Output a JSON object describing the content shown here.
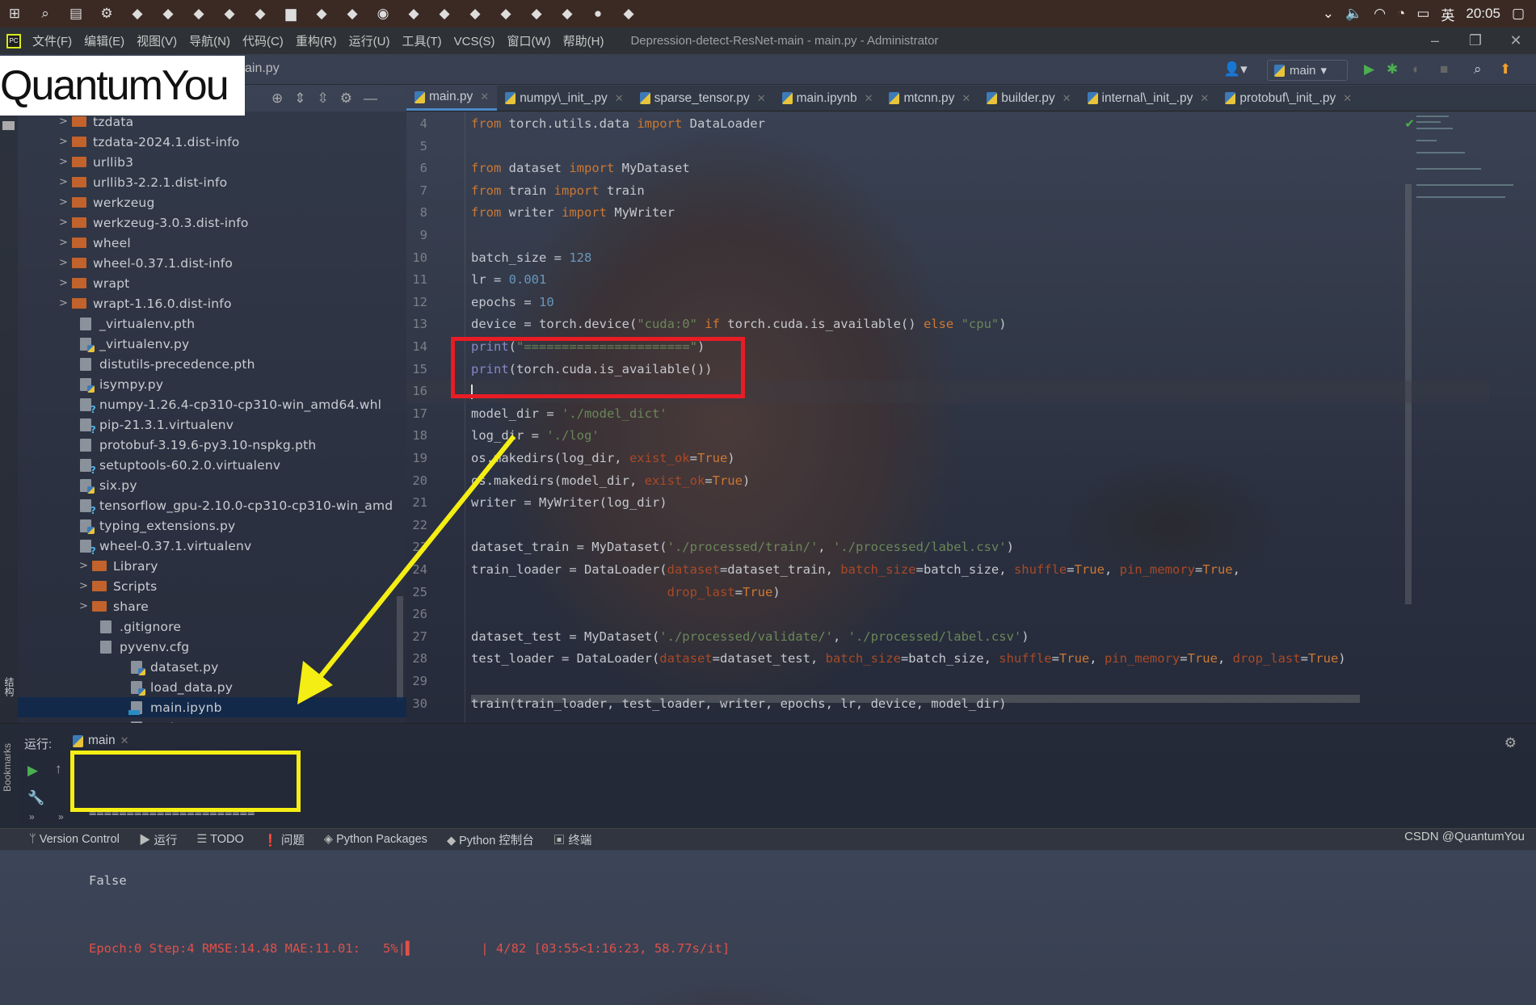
{
  "taskbar": {
    "icons": [
      "windows-icon",
      "search-icon",
      "task-view-icon",
      "gear-icon",
      "app-icon",
      "app-icon",
      "app-icon",
      "app-icon",
      "app-icon",
      "folder-icon",
      "search-app-icon",
      "app-icon",
      "edge-icon",
      "app-icon",
      "sublime-icon",
      "pycharm-icon",
      "app-icon",
      "app-icon",
      "app-icon",
      "wechat-icon",
      "app-icon"
    ],
    "ime": "英",
    "clock": "20:05"
  },
  "menubar": {
    "items": [
      "文件(F)",
      "编辑(E)",
      "视图(V)",
      "导航(N)",
      "代码(C)",
      "重构(R)",
      "运行(U)",
      "工具(T)",
      "VCS(S)",
      "窗口(W)",
      "帮助(H)"
    ],
    "title": "Depression-detect-ResNet-main - main.py - Administrator"
  },
  "watermark": "QuantumYou",
  "breadcrumb": "ain.py",
  "run_config": "main",
  "tabs": [
    {
      "label": "main.py",
      "active": true
    },
    {
      "label": "numpy\\_init_.py"
    },
    {
      "label": "sparse_tensor.py"
    },
    {
      "label": "main.ipynb",
      "type": "notebook"
    },
    {
      "label": "mtcnn.py"
    },
    {
      "label": "builder.py"
    },
    {
      "label": "internal\\_init_.py"
    },
    {
      "label": "protobuf\\_init_.py"
    }
  ],
  "tree": [
    {
      "label": "tzdata",
      "type": "folder",
      "depth": 2
    },
    {
      "label": "tzdata-2024.1.dist-info",
      "type": "folder",
      "depth": 2
    },
    {
      "label": "urllib3",
      "type": "folder",
      "depth": 2
    },
    {
      "label": "urllib3-2.2.1.dist-info",
      "type": "folder",
      "depth": 2
    },
    {
      "label": "werkzeug",
      "type": "folder",
      "depth": 2
    },
    {
      "label": "werkzeug-3.0.3.dist-info",
      "type": "folder",
      "depth": 2
    },
    {
      "label": "wheel",
      "type": "folder",
      "depth": 2
    },
    {
      "label": "wheel-0.37.1.dist-info",
      "type": "folder",
      "depth": 2
    },
    {
      "label": "wrapt",
      "type": "folder",
      "depth": 2
    },
    {
      "label": "wrapt-1.16.0.dist-info",
      "type": "folder",
      "depth": 2
    },
    {
      "label": "_virtualenv.pth",
      "type": "text",
      "depth": 2
    },
    {
      "label": "_virtualenv.py",
      "type": "py",
      "depth": 2
    },
    {
      "label": "distutils-precedence.pth",
      "type": "text",
      "depth": 2
    },
    {
      "label": "isympy.py",
      "type": "py",
      "depth": 2
    },
    {
      "label": "numpy-1.26.4-cp310-cp310-win_amd64.whl",
      "type": "unknown",
      "depth": 2
    },
    {
      "label": "pip-21.3.1.virtualenv",
      "type": "unknown",
      "depth": 2
    },
    {
      "label": "protobuf-3.19.6-py3.10-nspkg.pth",
      "type": "text",
      "depth": 2
    },
    {
      "label": "setuptools-60.2.0.virtualenv",
      "type": "unknown",
      "depth": 2
    },
    {
      "label": "six.py",
      "type": "py",
      "depth": 2
    },
    {
      "label": "tensorflow_gpu-2.10.0-cp310-cp310-win_amd",
      "type": "unknown",
      "depth": 2
    },
    {
      "label": "typing_extensions.py",
      "type": "py",
      "depth": 2
    },
    {
      "label": "wheel-0.37.1.virtualenv",
      "type": "unknown",
      "depth": 2
    },
    {
      "label": "Library",
      "type": "folder",
      "depth": 1
    },
    {
      "label": "Scripts",
      "type": "folder",
      "depth": 1
    },
    {
      "label": "share",
      "type": "folder",
      "depth": 1
    },
    {
      "label": ".gitignore",
      "type": "text",
      "depth": 1
    },
    {
      "label": "pyvenv.cfg",
      "type": "text",
      "depth": 1
    },
    {
      "label": "dataset.py",
      "type": "py",
      "depth": 0
    },
    {
      "label": "load_data.py",
      "type": "py",
      "depth": 0
    },
    {
      "label": "main.ipynb",
      "type": "nb",
      "depth": 0,
      "selected": true
    },
    {
      "label": "main.py",
      "type": "py",
      "depth": 0
    }
  ],
  "code": [
    {
      "n": "4",
      "t": [
        [
          "from",
          "kw"
        ],
        [
          " torch.utils.data ",
          "id"
        ],
        [
          "import",
          "kw"
        ],
        [
          " DataLoader",
          "id"
        ]
      ]
    },
    {
      "n": "5",
      "t": []
    },
    {
      "n": "6",
      "t": [
        [
          "from",
          "kw"
        ],
        [
          " dataset ",
          "id"
        ],
        [
          "import",
          "kw"
        ],
        [
          " MyDataset",
          "id"
        ]
      ]
    },
    {
      "n": "7",
      "t": [
        [
          "from",
          "kw"
        ],
        [
          " train ",
          "id"
        ],
        [
          "import",
          "kw"
        ],
        [
          " train",
          "id"
        ]
      ]
    },
    {
      "n": "8",
      "t": [
        [
          "from",
          "kw"
        ],
        [
          " writer ",
          "id"
        ],
        [
          "import",
          "kw"
        ],
        [
          " MyWriter",
          "id"
        ]
      ]
    },
    {
      "n": "9",
      "t": []
    },
    {
      "n": "10",
      "t": [
        [
          "batch_size = ",
          "id"
        ],
        [
          "128",
          "num"
        ]
      ]
    },
    {
      "n": "11",
      "t": [
        [
          "lr = ",
          "id"
        ],
        [
          "0.001",
          "num"
        ]
      ]
    },
    {
      "n": "12",
      "t": [
        [
          "epochs = ",
          "id"
        ],
        [
          "10",
          "num"
        ]
      ]
    },
    {
      "n": "13",
      "t": [
        [
          "device = torch.device(",
          "id"
        ],
        [
          "\"cuda:0\"",
          "str"
        ],
        [
          " if ",
          "kw"
        ],
        [
          "torch.cuda.is_available() ",
          "id"
        ],
        [
          "else",
          "kw"
        ],
        [
          " \"cpu\"",
          "str"
        ],
        [
          ")",
          "id"
        ]
      ]
    },
    {
      "n": "14",
      "t": [
        [
          "print",
          "bi"
        ],
        [
          "(",
          "id"
        ],
        [
          "\"======================\"",
          "str"
        ],
        [
          ")",
          "id"
        ]
      ]
    },
    {
      "n": "15",
      "t": [
        [
          "print",
          "bi"
        ],
        [
          "(torch.cuda.is_available())",
          "id"
        ]
      ]
    },
    {
      "n": "16",
      "t": [],
      "current": true
    },
    {
      "n": "17",
      "t": [
        [
          "model_dir = ",
          "id"
        ],
        [
          "'./model_dict'",
          "str"
        ]
      ]
    },
    {
      "n": "18",
      "t": [
        [
          "log_dir = ",
          "id"
        ],
        [
          "'./log'",
          "str"
        ]
      ]
    },
    {
      "n": "19",
      "t": [
        [
          "os.makedirs(log_dir, ",
          "id"
        ],
        [
          "exist_ok",
          "param"
        ],
        [
          "=",
          "id"
        ],
        [
          "True",
          "kw"
        ],
        [
          ")",
          "id"
        ]
      ]
    },
    {
      "n": "20",
      "t": [
        [
          "os.makedirs(model_dir, ",
          "id"
        ],
        [
          "exist_ok",
          "param"
        ],
        [
          "=",
          "id"
        ],
        [
          "True",
          "kw"
        ],
        [
          ")",
          "id"
        ]
      ]
    },
    {
      "n": "21",
      "t": [
        [
          "writer = MyWriter(log_dir)",
          "id"
        ]
      ]
    },
    {
      "n": "22",
      "t": []
    },
    {
      "n": "23",
      "t": [
        [
          "dataset_train = MyDataset(",
          "id"
        ],
        [
          "'./processed/train/'",
          "str"
        ],
        [
          ", ",
          "id"
        ],
        [
          "'./processed/label.csv'",
          "str"
        ],
        [
          ")",
          "id"
        ]
      ]
    },
    {
      "n": "24",
      "t": [
        [
          "train_loader = DataLoader(",
          "id"
        ],
        [
          "dataset",
          "param"
        ],
        [
          "=dataset_train, ",
          "id"
        ],
        [
          "batch_size",
          "param"
        ],
        [
          "=batch_size, ",
          "id"
        ],
        [
          "shuffle",
          "param"
        ],
        [
          "=",
          "id"
        ],
        [
          "True",
          "kw"
        ],
        [
          ", ",
          "id"
        ],
        [
          "pin_memory",
          "param"
        ],
        [
          "=",
          "id"
        ],
        [
          "True",
          "kw"
        ],
        [
          ",",
          "id"
        ]
      ]
    },
    {
      "n": "25",
      "t": [
        [
          "                          ",
          "id"
        ],
        [
          "drop_last",
          "param"
        ],
        [
          "=",
          "id"
        ],
        [
          "True",
          "kw"
        ],
        [
          ")",
          "id"
        ]
      ]
    },
    {
      "n": "26",
      "t": []
    },
    {
      "n": "27",
      "t": [
        [
          "dataset_test = MyDataset(",
          "id"
        ],
        [
          "'./processed/validate/'",
          "str"
        ],
        [
          ", ",
          "id"
        ],
        [
          "'./processed/label.csv'",
          "str"
        ],
        [
          ")",
          "id"
        ]
      ]
    },
    {
      "n": "28",
      "t": [
        [
          "test_loader = DataLoader(",
          "id"
        ],
        [
          "dataset",
          "param"
        ],
        [
          "=dataset_test, ",
          "id"
        ],
        [
          "batch_size",
          "param"
        ],
        [
          "=batch_size, ",
          "id"
        ],
        [
          "shuffle",
          "param"
        ],
        [
          "=",
          "id"
        ],
        [
          "True",
          "kw"
        ],
        [
          ", ",
          "id"
        ],
        [
          "pin_memory",
          "param"
        ],
        [
          "=",
          "id"
        ],
        [
          "True",
          "kw"
        ],
        [
          ", ",
          "id"
        ],
        [
          "drop_last",
          "param"
        ],
        [
          "=",
          "id"
        ],
        [
          "True",
          "kw"
        ],
        [
          ")",
          "id"
        ]
      ]
    },
    {
      "n": "29",
      "t": []
    },
    {
      "n": "30",
      "t": [
        [
          "train(train_loader, test_loader, writer, epochs, lr, device, model_dir)",
          "id"
        ]
      ]
    }
  ],
  "run": {
    "label": "运行:",
    "tab": "main",
    "output": [
      "======================",
      "False"
    ],
    "progress": "Epoch:0 Step:4 RMSE:14.48 MAE:11.01:   5%|▌         | 4/82 [03:55<1:16:23, 58.77s/it]",
    "progress_percent": 5
  },
  "sidebar_labels": {
    "bookmarks": "Bookmarks",
    "structure": "结构"
  },
  "statusbar": {
    "items": [
      "Version Control",
      "运行",
      "TODO",
      "问题",
      "Python Packages",
      "Python 控制台",
      "终端"
    ],
    "icons": [
      "vcs-icon",
      "run-icon",
      "todo-icon",
      "problems-icon",
      "packages-icon",
      "python-console-icon",
      "terminal-icon"
    ]
  },
  "credit": "CSDN @QuantumYou",
  "colors": {
    "annotation_red": "#e81c24",
    "annotation_yellow": "#f5ee14",
    "keyword": "#cc7832",
    "string": "#6a8759",
    "number": "#6897bb",
    "error_output": "#e0504a"
  }
}
